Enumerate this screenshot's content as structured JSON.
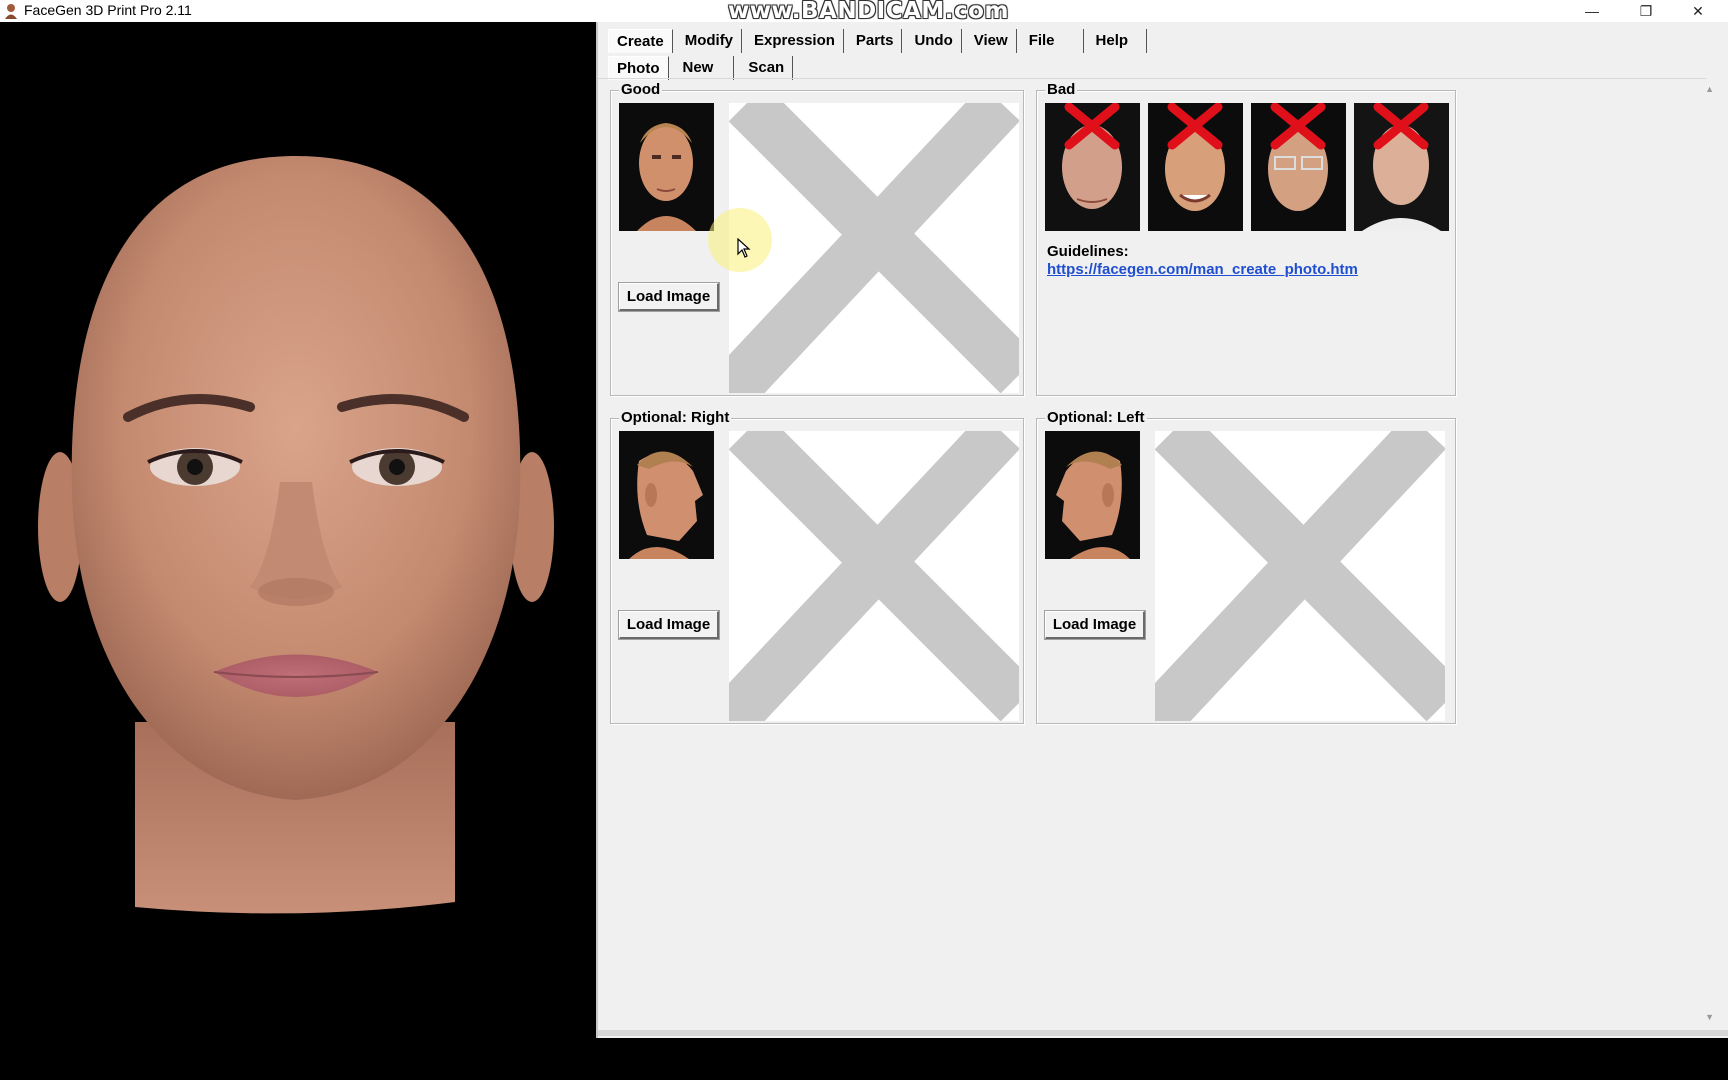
{
  "window": {
    "title": "FaceGen 3D Print Pro 2.11",
    "watermark": "www.BANDICAM.com",
    "controls": {
      "minimize": "—",
      "restore": "❐",
      "close": "✕"
    }
  },
  "menu": {
    "items": [
      {
        "label": "Create",
        "active": true
      },
      {
        "label": "Modify"
      },
      {
        "label": "Expression"
      },
      {
        "label": "Parts"
      },
      {
        "label": "Undo"
      },
      {
        "label": "View"
      },
      {
        "label": "File"
      },
      {
        "label": "Help"
      }
    ]
  },
  "submenu": {
    "items": [
      {
        "label": "Photo",
        "active": true
      },
      {
        "label": "New"
      },
      {
        "label": "Scan"
      }
    ]
  },
  "groups": {
    "good": {
      "title": "Good",
      "button": "Load Image"
    },
    "bad": {
      "title": "Bad",
      "guidelines_label": "Guidelines:",
      "guidelines_link": "https://facegen.com/man_create_photo.htm"
    },
    "right": {
      "title": "Optional: Right",
      "button": "Load Image"
    },
    "left": {
      "title": "Optional: Left",
      "button": "Load Image"
    }
  },
  "colors": {
    "panel_bg": "#f0f0f0",
    "link": "#1f4fd0",
    "reject_mark": "#e0101a",
    "placeholder_x": "#c8c8c8"
  }
}
